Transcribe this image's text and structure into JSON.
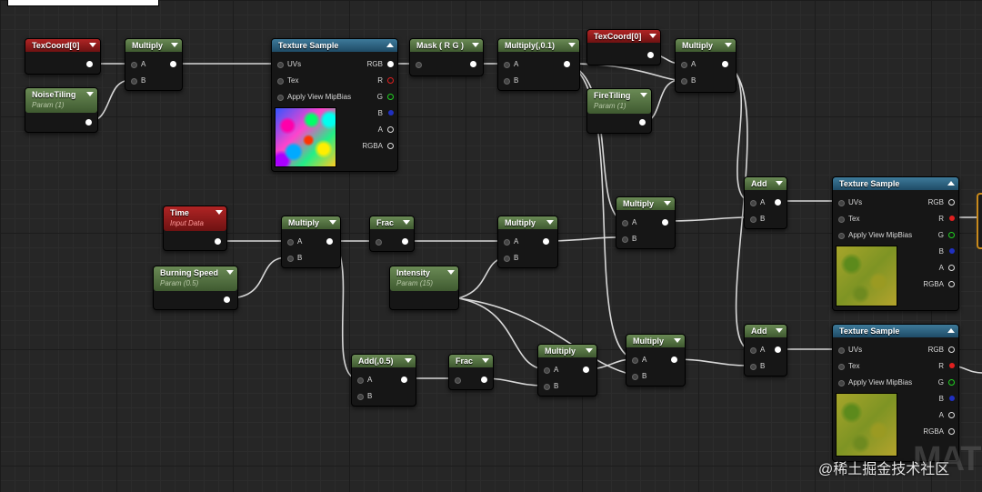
{
  "watermark": "@稀土掘金技术社区",
  "mat_text": "MAT",
  "nodes": {
    "texcoord_a": {
      "title": "TexCoord[0]"
    },
    "noise_tiling": {
      "title": "NoiseTiling",
      "sub": "Param (1)"
    },
    "multiply_1": {
      "title": "Multiply",
      "a": "A",
      "b": "B"
    },
    "texsample_1": {
      "title": "Texture Sample",
      "uvs": "UVs",
      "tex": "Tex",
      "mip": "Apply View MipBias",
      "rgb": "RGB",
      "r": "R",
      "g": "G",
      "bl": "B",
      "a": "A",
      "rgba": "RGBA"
    },
    "mask": {
      "title": "Mask ( R G )"
    },
    "multiply_01": {
      "title": "Multiply(,0.1)",
      "a": "A",
      "b": "B"
    },
    "texcoord_b": {
      "title": "TexCoord[0]"
    },
    "fire_tiling": {
      "title": "FireTiling",
      "sub": "Param (1)"
    },
    "multiply_2": {
      "title": "Multiply",
      "a": "A",
      "b": "B"
    },
    "add_1": {
      "title": "Add",
      "a": "A",
      "b": "B"
    },
    "texsample_2": {
      "title": "Texture Sample",
      "uvs": "UVs",
      "tex": "Tex",
      "mip": "Apply View MipBias",
      "rgb": "RGB",
      "r": "R",
      "g": "G",
      "bl": "B",
      "a": "A",
      "rgba": "RGBA"
    },
    "time": {
      "title": "Time",
      "sub": "Input Data"
    },
    "multiply_3": {
      "title": "Multiply",
      "a": "A",
      "b": "B"
    },
    "frac_1": {
      "title": "Frac"
    },
    "multiply_4": {
      "title": "Multiply",
      "a": "A",
      "b": "B"
    },
    "multiply_5": {
      "title": "Multiply",
      "a": "A",
      "b": "B"
    },
    "burning_speed": {
      "title": "Burning Speed",
      "sub": "Param (0.5)"
    },
    "intensity": {
      "title": "Intensity",
      "sub": "Param (15)"
    },
    "add_05": {
      "title": "Add(,0.5)",
      "a": "A",
      "b": "B"
    },
    "frac_2": {
      "title": "Frac"
    },
    "multiply_6": {
      "title": "Multiply",
      "a": "A",
      "b": "B"
    },
    "multiply_7": {
      "title": "Multiply",
      "a": "A",
      "b": "B"
    },
    "add_2": {
      "title": "Add",
      "a": "A",
      "b": "B"
    },
    "texsample_3": {
      "title": "Texture Sample",
      "uvs": "UVs",
      "tex": "Tex",
      "mip": "Apply View MipBias",
      "rgb": "RGB",
      "r": "R",
      "g": "G",
      "bl": "B",
      "a": "A",
      "rgba": "RGBA"
    }
  },
  "colors": {
    "wire": "#d8d8d8",
    "background": "#262626",
    "selected_outline": "#c98a1c"
  }
}
